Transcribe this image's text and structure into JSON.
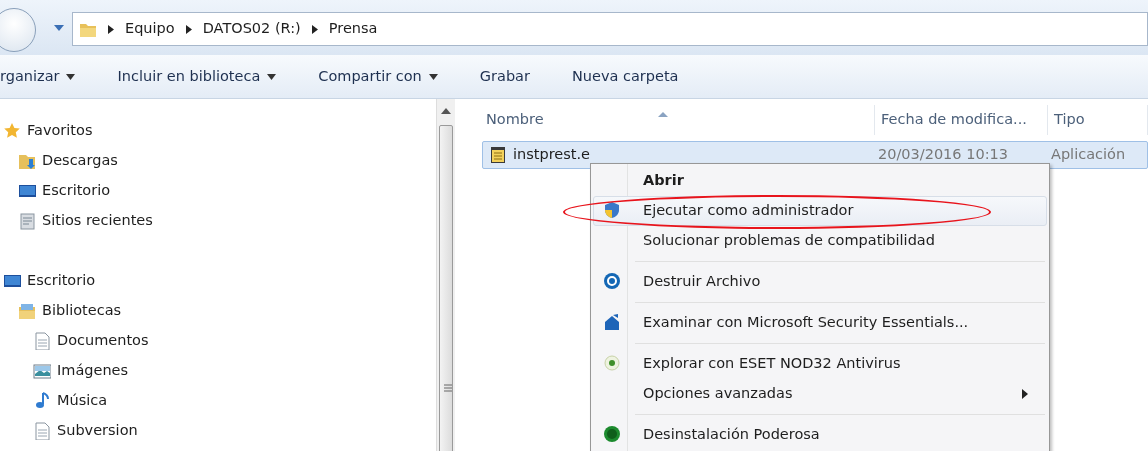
{
  "address": {
    "crumbs": [
      "Equipo",
      "DATOS02 (R:)",
      "Prensa"
    ]
  },
  "toolbar": [
    {
      "label": "rganizar",
      "dropdown": true
    },
    {
      "label": "Incluir en biblioteca",
      "dropdown": true
    },
    {
      "label": "Compartir con",
      "dropdown": true
    },
    {
      "label": "Grabar",
      "dropdown": false
    },
    {
      "label": "Nueva carpeta",
      "dropdown": false
    }
  ],
  "navigation": [
    {
      "label": "Favoritos",
      "kind": "star",
      "children": [
        {
          "label": "Descargas",
          "kind": "downloads"
        },
        {
          "label": "Escritorio",
          "kind": "desktop"
        },
        {
          "label": "Sitios recientes",
          "kind": "recent"
        }
      ]
    },
    {
      "label": "Escritorio",
      "kind": "desktop",
      "children": [
        {
          "label": "Bibliotecas",
          "kind": "library",
          "children": [
            {
              "label": "Documentos",
              "kind": "document"
            },
            {
              "label": "Imágenes",
              "kind": "images"
            },
            {
              "label": "Música",
              "kind": "music"
            },
            {
              "label": "Subversion",
              "kind": "document"
            }
          ]
        }
      ]
    }
  ],
  "columns": [
    "Nombre",
    "Fecha de modifica...",
    "Tipo"
  ],
  "files": [
    {
      "name": "instprest.e",
      "date": "20/03/2016 10:13",
      "type": "Aplicación",
      "selected": true
    }
  ],
  "context_menu": {
    "groups": [
      [
        {
          "label": "Abrir",
          "bold": true,
          "highlighted": false
        },
        {
          "label": "Ejecutar como administrador",
          "kind": "shield",
          "bold": false,
          "highlighted": true
        },
        {
          "label": "Solucionar problemas de compatibilidad",
          "bold": false,
          "highlighted": false
        }
      ],
      [
        {
          "label": "Destruir Archivo",
          "kind": "disc",
          "bold": false,
          "highlighted": false
        }
      ],
      [
        {
          "label": "Examinar con Microsoft Security Essentials...",
          "kind": "house",
          "bold": false,
          "highlighted": false
        }
      ],
      [
        {
          "label": "Explorar con ESET NOD32 Antivirus",
          "kind": "eye",
          "bold": false,
          "highlighted": false
        },
        {
          "label": "Opciones avanzadas",
          "bold": false,
          "highlighted": false,
          "submenu": true
        }
      ],
      [
        {
          "label": "Desinstalación Poderosa",
          "kind": "badge",
          "bold": false,
          "highlighted": false
        }
      ]
    ]
  }
}
